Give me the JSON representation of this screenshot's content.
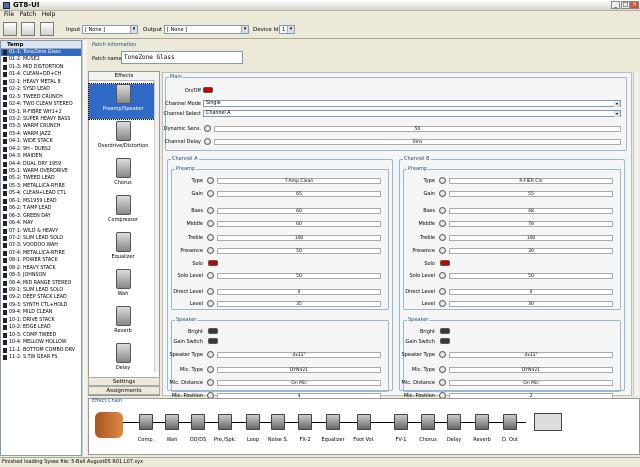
{
  "window": {
    "title": "GT8-UI"
  },
  "menu": [
    "File",
    "Patch",
    "Help"
  ],
  "toolbar": {
    "input_label": "Input",
    "input_value": "[ None ]",
    "output_label": "Output",
    "output_value": "[ None ]",
    "device_label": "Device Id",
    "device_value": "1"
  },
  "patchlist": {
    "header": "Temp",
    "items": [
      "01-1: ToneZone Glass",
      "01-2: MUSE2",
      "01-3: MID DISTORTION",
      "01-4: CLEAN+DD+CH",
      "02-1: HEAVY METAL 8",
      "02-2: SYSD LEAD",
      "02-3: TWEED CRUNCH",
      "02-4: TWO CLEAN STEREO",
      "03-1: R-FIBRE WH1+2",
      "03-2: SUPER HEAVY BASS",
      "03-3: WARM CRUNCH",
      "03-4: WARM JAZZ",
      "04-1: WIDE STACK",
      "04-2: 9H - DUBS2",
      "04-3: MAIDEN",
      "04-4: DUAL DRY 1959",
      "05-1: WARM OVERDRIVE",
      "05-2: TWEED LEAD",
      "05-3: METALLICA-RFIRE",
      "05-4: CLEAN+LEAD CTL",
      "06-1: MS1959 LEAD",
      "06-2: T.AMP LEAD",
      "06-3: GREEN DAY",
      "06-4: MAY",
      "07-1: WILD & HEAVY",
      "07-2: SLIM LEAD SOLO",
      "07-3: VOODOO WAH",
      "07-4: METALLICA-RFIRE",
      "08-1: POWER STACK",
      "08-2: HEAVY STACK",
      "08-3: JOHNSON",
      "08-4: MID RANGE STEREO",
      "09-1: SLIM LEAD SOLO",
      "09-2: DEEP STACK LEAD",
      "09-3: SYNTH CTL+HOLD",
      "09-4: MILD CLEAN",
      "10-1: DRIVE STACK",
      "10-2: EDGE LEAD",
      "10-3: COMP TWEED",
      "10-4: MELLOW HOLLOW",
      "11-1: BOTTOM COMBO DRV",
      "11-2: S.TW GEAR FS"
    ]
  },
  "patchinfo": {
    "section": "Patch Information",
    "name_label": "Patch name",
    "name_value": "ToneZone Glass"
  },
  "effects": {
    "header": "Effects",
    "items": [
      "Preamp/Speaker",
      "Overdrive/Distortion",
      "Chorus",
      "Compressor",
      "Equalizer",
      "Wah",
      "Reverb",
      "Delay"
    ],
    "settings": "Settings",
    "assignments": "Assignments"
  },
  "main": {
    "section": "Main",
    "onoff": "On/Off",
    "channel_mode_label": "Channel Mode",
    "channel_mode": "Single",
    "channel_select_label": "Channel Select",
    "channel_select": "Channel A",
    "dyn_sens_label": "Dynamic Sens.",
    "dyn_sens": "50",
    "ch_delay_label": "Channel Delay",
    "ch_delay": "0ms"
  },
  "chA": {
    "title": "Channel A",
    "preamp": "Preamp",
    "type_label": "Type",
    "type": "T-Amp Clean",
    "gain_label": "Gain",
    "gain": "65",
    "bass_label": "Bass",
    "bass": "60",
    "middle_label": "Middle",
    "middle": "60",
    "treble_label": "Treble",
    "treble": "100",
    "presence_label": "Presence",
    "presence": "50",
    "solo_label": "Solo",
    "solo_level_label": "Solo Level",
    "solo_level": "50",
    "direct_label": "Direct Level",
    "direct": "0",
    "level_label": "Level",
    "level": "35",
    "speaker": "Speaker",
    "bright_label": "Bright",
    "gainsw_label": "Gain Switch",
    "sptype_label": "Speaker Type",
    "sptype": "4x12\"",
    "mictype_label": "Mic. Type",
    "mictype": "DYN421",
    "micdist_label": "Mic. Distance",
    "micdist": "On Mic",
    "micpos_label": "Mic. Position",
    "micpos": "4"
  },
  "chB": {
    "title": "Channel B",
    "preamp": "Preamp",
    "type_label": "Type",
    "type": "R-FIER Cln",
    "gain_label": "Gain",
    "gain": "55",
    "bass_label": "Bass",
    "bass": "48",
    "middle_label": "Middle",
    "middle": "78",
    "treble_label": "Treble",
    "treble": "100",
    "presence_label": "Presence",
    "presence": "30",
    "solo_label": "Solo",
    "solo_level_label": "Solo Level",
    "solo_level": "50",
    "direct_label": "Direct Level",
    "direct": "0",
    "level_label": "Level",
    "level": "30",
    "speaker": "Speaker",
    "bright_label": "Bright",
    "gainsw_label": "Gain Switch",
    "sptype_label": "Speaker Type",
    "sptype": "4x12\"",
    "mictype_label": "Mic. Type",
    "mictype": "DYN421",
    "micdist_label": "Mic. Distance",
    "micdist": "On Mic",
    "micpos_label": "Mic. Position",
    "micpos": "2"
  },
  "chain": {
    "title": "Effect Chain",
    "labels": [
      "Comp.",
      "Wah",
      "OD/DS",
      "Pre./Spk.",
      "Loop",
      "Noise S.",
      "FX-2",
      "Equalizer",
      "Foot Vol.",
      "FV-1",
      "Chorus",
      "Delay",
      "Reverb",
      "D. Out"
    ]
  },
  "status": "Finished loading Sysex file: 5-Ball August05 R01.L07.syx"
}
